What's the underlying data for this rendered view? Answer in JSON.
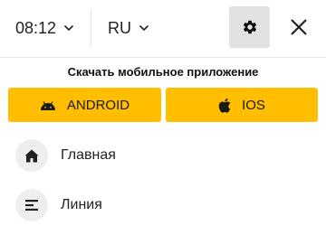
{
  "header": {
    "time_label": "08:12",
    "language_label": "RU",
    "settings_icon": "gear-icon",
    "close_icon": "close-icon"
  },
  "promo": {
    "title": "Скачать мобильное приложение",
    "android_label": "ANDROID",
    "ios_label": "IOS",
    "button_color": "#ffbf00"
  },
  "menu": {
    "items": [
      {
        "label": "Главная",
        "icon": "home-icon"
      },
      {
        "label": "Линия",
        "icon": "list-icon"
      }
    ]
  },
  "colors": {
    "accent": "#ffbf00",
    "text": "#222222",
    "icon_bg": "#eeeeee",
    "settings_bg": "#e2e2e2"
  }
}
